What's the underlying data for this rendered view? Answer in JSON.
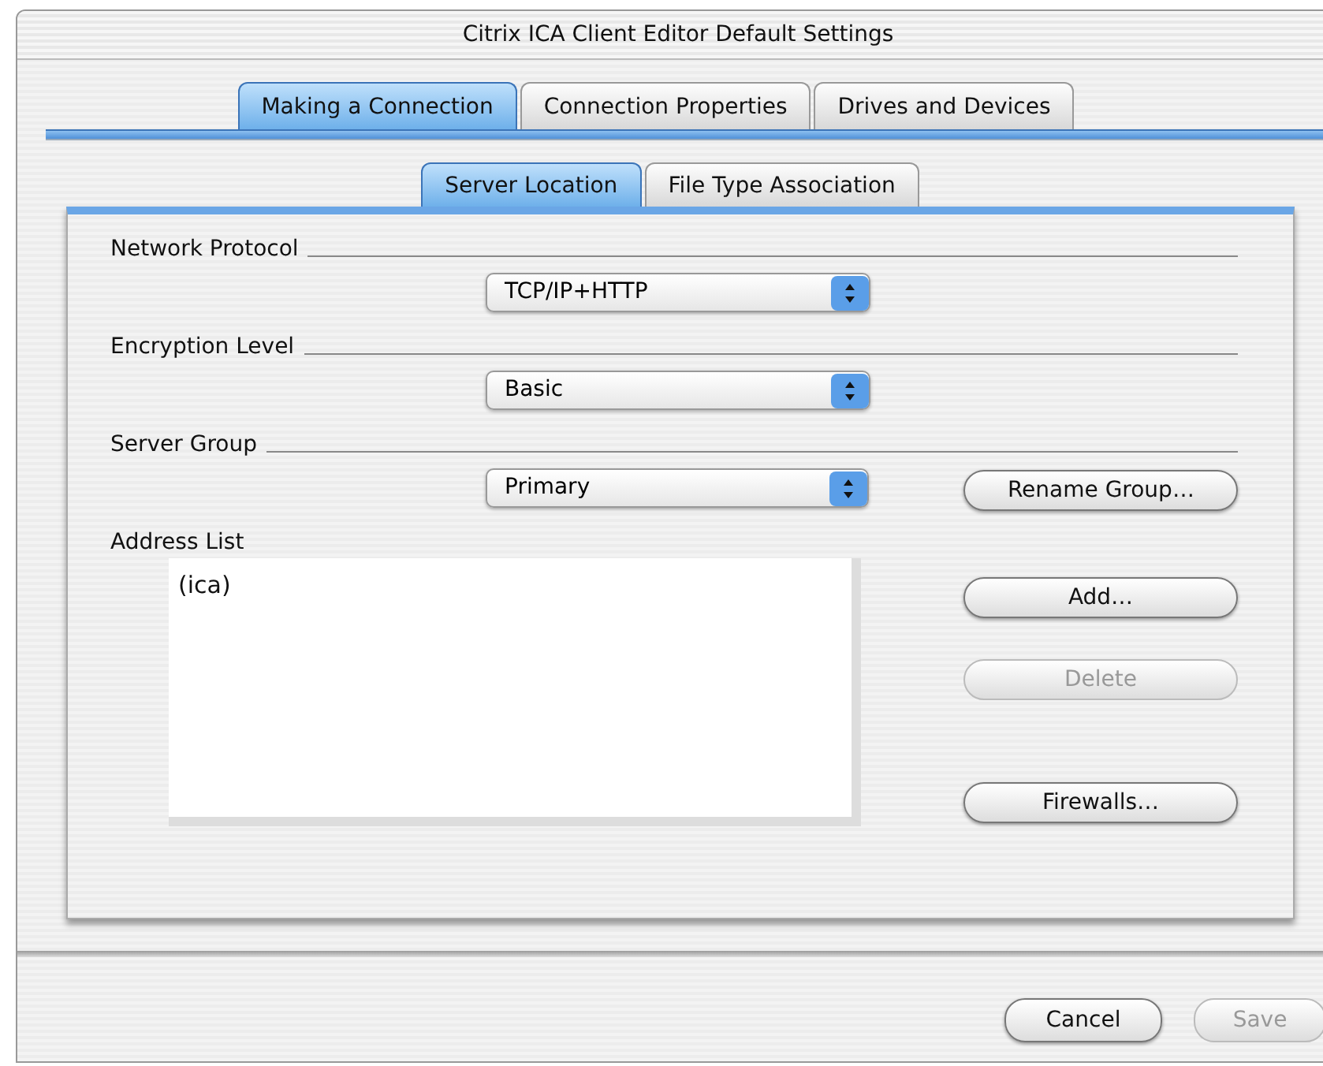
{
  "window": {
    "title": "Citrix ICA Client Editor Default Settings"
  },
  "tabs": [
    {
      "label": "Making a Connection",
      "selected": true
    },
    {
      "label": "Connection Properties",
      "selected": false
    },
    {
      "label": "Drives and Devices",
      "selected": false
    }
  ],
  "subtabs": [
    {
      "label": "Server Location",
      "selected": true
    },
    {
      "label": "File Type Association",
      "selected": false
    }
  ],
  "sections": [
    {
      "label": "Network Protocol",
      "popup": "TCP/IP+HTTP"
    },
    {
      "label": "Encryption Level",
      "popup": "Basic"
    },
    {
      "label": "Server Group",
      "popup": "Primary",
      "button": "Rename Group…"
    }
  ],
  "address_list": {
    "label": "Address List",
    "items": [
      "(ica)"
    ]
  },
  "side_buttons": [
    {
      "label": "Add…",
      "disabled": false
    },
    {
      "label": "Delete",
      "disabled": true
    },
    {
      "label": "Firewalls…",
      "disabled": false
    }
  ],
  "buttons": [
    {
      "label": "Cancel",
      "disabled": false
    },
    {
      "label": "Save",
      "disabled": true
    }
  ]
}
